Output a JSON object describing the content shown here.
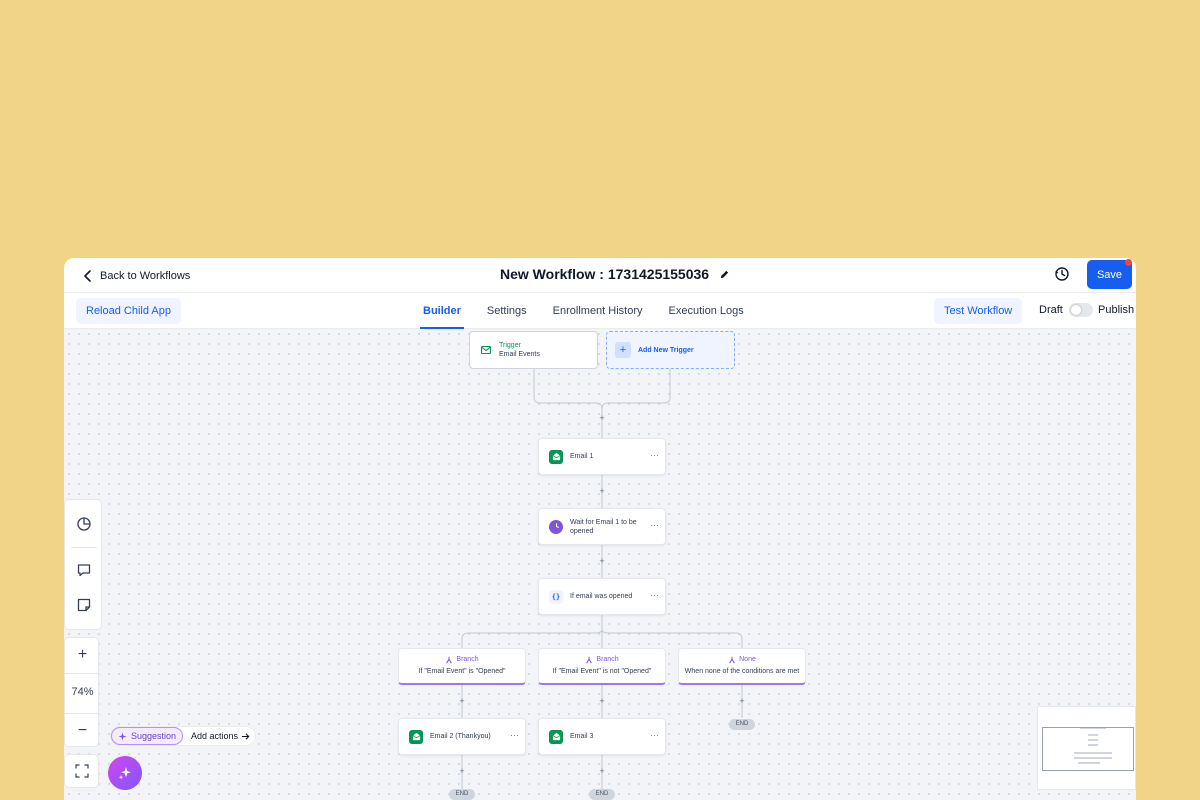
{
  "header": {
    "back_label": "Back to Workflows",
    "workflow_title": "New Workflow : 1731425155036",
    "save_label": "Save"
  },
  "subheader": {
    "reload_label": "Reload Child App",
    "tabs": [
      {
        "label": "Builder",
        "active": true
      },
      {
        "label": "Settings",
        "active": false
      },
      {
        "label": "Enrollment History",
        "active": false
      },
      {
        "label": "Execution Logs",
        "active": false
      }
    ],
    "test_label": "Test Workflow",
    "draft_label": "Draft",
    "publish_label": "Publish",
    "published": false
  },
  "canvas": {
    "trigger": {
      "title": "Trigger",
      "subtitle": "Email Events"
    },
    "add_trigger_label": "Add New Trigger",
    "nodes": [
      {
        "label": "Email 1",
        "icon": "email-icon"
      },
      {
        "label": "Wait for Email 1 to be opened",
        "icon": "clock-icon"
      },
      {
        "label": "If email was opened",
        "icon": "condition-icon"
      }
    ],
    "branches": [
      {
        "title": "Branch",
        "desc": "If \"Email Event\" is \"Opened\""
      },
      {
        "title": "Branch",
        "desc": "If \"Email Event\" is not \"Opened\""
      },
      {
        "title": "None",
        "desc": "When none of the conditions are met"
      }
    ],
    "branch_actions": [
      {
        "label": "Email 2 (Thankyou)"
      },
      {
        "label": "Email 3"
      }
    ],
    "end_label": "END",
    "plus": "+",
    "dots": "···"
  },
  "tools": {
    "zoom_in": "+",
    "zoom_level": "74%",
    "zoom_out": "−",
    "suggestion_label": "Suggestion",
    "add_actions_label": "Add actions"
  },
  "colors": {
    "background": "#F2D488",
    "primary": "#155EEF",
    "branch_accent": "#9E77ED",
    "email_icon": "#079455",
    "wait_icon": "#7F56D9"
  }
}
